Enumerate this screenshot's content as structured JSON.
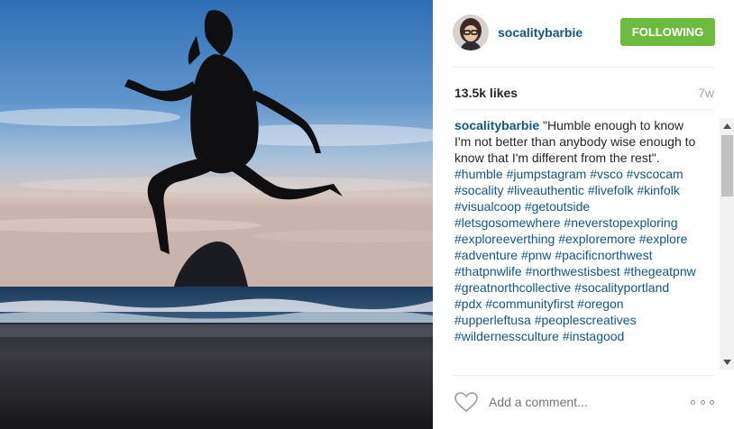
{
  "post": {
    "photo_icon": "post-photo",
    "username": "socalitybarbie",
    "follow_label": "FOLLOWING",
    "likes": "13.5k likes",
    "age": "7w",
    "caption_author": "socalitybarbie",
    "caption_text": "\"Humble enough to know I'm not better than anybody wise enough to know that I'm different from the rest\".",
    "hashtags": [
      "#humble",
      "#jumpstagram",
      "#vsco",
      "#vscocam",
      "#socality",
      "#liveauthentic",
      "#livefolk",
      "#kinfolk",
      "#visualcoop",
      "#getoutside",
      "#letsgosomewhere",
      "#neverstopexploring",
      "#exploreeverthing",
      "#exploremore",
      "#explore",
      "#adventure",
      "#pnw",
      "#pacificnorthwest",
      "#thatpnwlife",
      "#northwestisbest",
      "#thegeatpnw",
      "#greatnorthcollective",
      "#socalityportland",
      "#pdx",
      "#communityfirst",
      "#oregon",
      "#upperleftusa",
      "#peoplescreatives",
      "#wildernessculture",
      "#instagood"
    ],
    "comment_placeholder": "Add a comment...",
    "colors": {
      "link": "#125688",
      "follow_bg": "#6dbb3f",
      "muted": "#a5a7aa"
    },
    "icons": {
      "like": "heart-icon",
      "more": "more-options-icon"
    }
  }
}
